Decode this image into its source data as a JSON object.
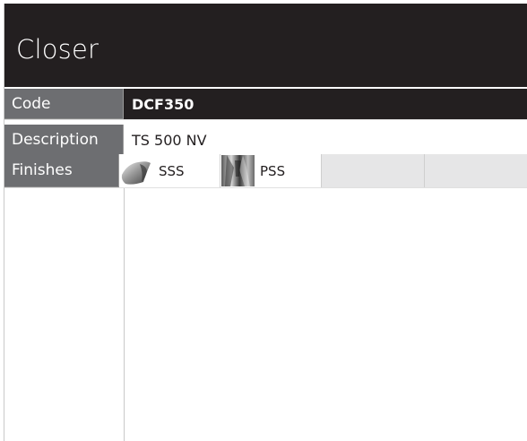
{
  "title": "Closer",
  "rows": {
    "code": {
      "label": "Code",
      "value": "DCF350"
    },
    "description": {
      "label": "Description",
      "value": "TS 500 NV"
    },
    "finishes": {
      "label": "Finishes",
      "items": [
        {
          "name": "SSS",
          "swatch": "satin-stainless-swatch-icon"
        },
        {
          "name": "PSS",
          "swatch": "polished-stainless-swatch-icon"
        }
      ]
    }
  },
  "colors": {
    "header_bg": "#231f20",
    "label_bg": "#6d6e71",
    "empty_cell_bg": "#e6e6e7"
  }
}
